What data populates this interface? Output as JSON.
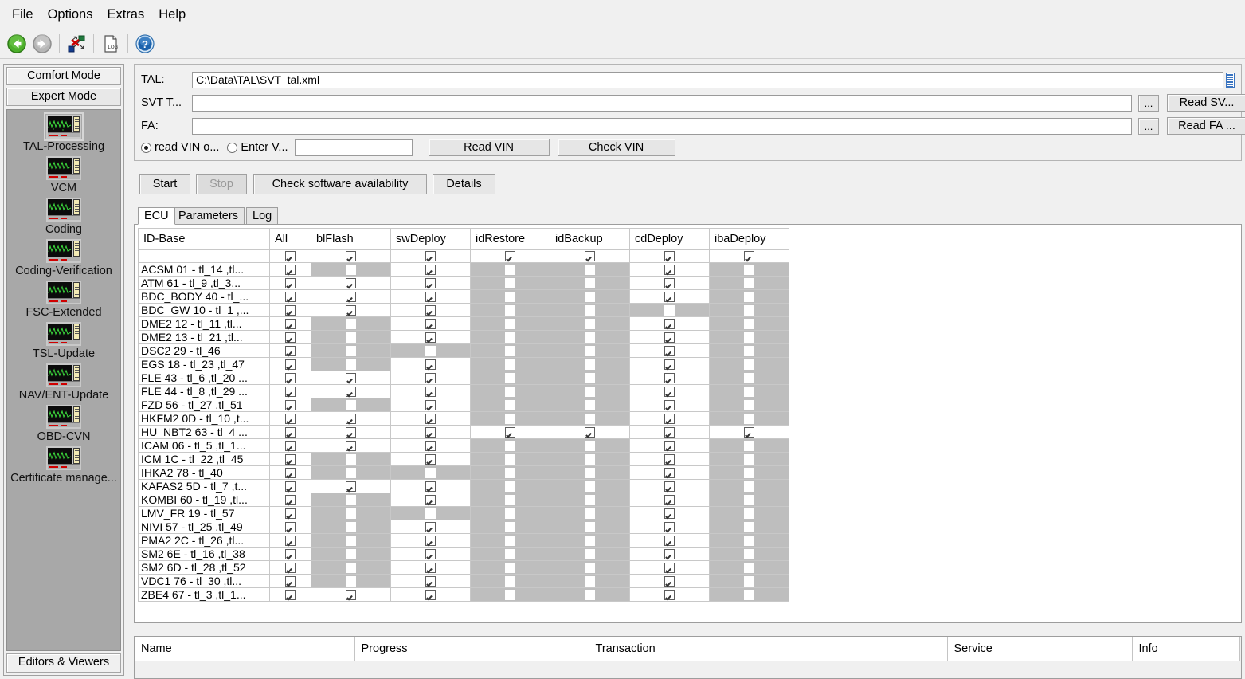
{
  "menubar": {
    "items": [
      "File",
      "Options",
      "Extras",
      "Help"
    ]
  },
  "toolbar": {
    "buttons": [
      {
        "name": "back-button",
        "icon": "back-arrow-icon",
        "enabled": true
      },
      {
        "name": "forward-button",
        "icon": "forward-arrow-icon",
        "enabled": false
      },
      {
        "name": "abort-connection-button",
        "icon": "abort-network-icon",
        "enabled": true
      },
      {
        "name": "log-file-button",
        "icon": "log-document-icon",
        "enabled": true
      },
      {
        "name": "help-button",
        "icon": "help-question-icon",
        "enabled": true
      }
    ]
  },
  "sidebar": {
    "modes": [
      {
        "label": "Comfort Mode",
        "selected": false
      },
      {
        "label": "Expert Mode",
        "selected": true
      }
    ],
    "items": [
      {
        "label": "TAL-Processing",
        "icon": "oscilloscope-icon",
        "active": true
      },
      {
        "label": "VCM",
        "icon": "oscilloscope-icon",
        "active": false
      },
      {
        "label": "Coding",
        "icon": "oscilloscope-icon",
        "active": false
      },
      {
        "label": "Coding-Verification",
        "icon": "oscilloscope-icon",
        "active": false
      },
      {
        "label": "FSC-Extended",
        "icon": "oscilloscope-icon",
        "active": false
      },
      {
        "label": "TSL-Update",
        "icon": "oscilloscope-icon",
        "active": false
      },
      {
        "label": "NAV/ENT-Update",
        "icon": "oscilloscope-icon",
        "active": false
      },
      {
        "label": "OBD-CVN",
        "icon": "oscilloscope-icon",
        "active": false
      },
      {
        "label": "Certificate manage...",
        "icon": "oscilloscope-icon",
        "active": false
      }
    ],
    "footer_button": "Editors & Viewers"
  },
  "form": {
    "tal_label": "TAL:",
    "tal_value": "C:\\Data\\TAL\\SVT  tal.xml",
    "svt_label": "SVT T...",
    "svt_value": "",
    "svt_browse": "...",
    "svt_read_button": "Read SV...",
    "fa_label": "FA:",
    "fa_value": "",
    "fa_browse": "...",
    "fa_read_button": "Read FA ...",
    "radio_read_vin": "read VIN o...",
    "radio_enter_vin": "Enter V...",
    "vin_value": "",
    "read_vin_button": "Read VIN",
    "check_vin_button": "Check VIN",
    "selected_radio": "read_vin"
  },
  "actions": {
    "start": "Start",
    "stop": "Stop",
    "stop_enabled": false,
    "check_availability": "Check software availability",
    "details": "Details"
  },
  "tabs": [
    {
      "label": "ECU",
      "active": true
    },
    {
      "label": "Parameters",
      "active": false
    },
    {
      "label": "Log",
      "active": false
    }
  ],
  "ecu_table": {
    "columns": [
      "ID-Base",
      "All",
      "blFlash",
      "swDeploy",
      "idRestore",
      "idBackup",
      "cdDeploy",
      "ibaDeploy"
    ],
    "header_row_checks": [
      true,
      true,
      true,
      true,
      true,
      true,
      true
    ],
    "rows": [
      {
        "id": "ACSM 01 - tl_14 ,tl...",
        "cells": [
          "c",
          "d",
          "c",
          "d",
          "d",
          "c",
          "d"
        ]
      },
      {
        "id": "ATM 61 - tl_9 ,tl_3...",
        "cells": [
          "c",
          "c",
          "c",
          "d",
          "d",
          "c",
          "d"
        ]
      },
      {
        "id": "BDC_BODY 40 - tl_...",
        "cells": [
          "c",
          "c",
          "c",
          "d",
          "d",
          "c",
          "d"
        ]
      },
      {
        "id": "BDC_GW 10 - tl_1 ,...",
        "cells": [
          "c",
          "c",
          "c",
          "d",
          "d",
          "d",
          "d"
        ]
      },
      {
        "id": "DME2 12 - tl_11 ,tl...",
        "cells": [
          "c",
          "d",
          "c",
          "d",
          "d",
          "c",
          "d"
        ]
      },
      {
        "id": "DME2 13 - tl_21 ,tl...",
        "cells": [
          "c",
          "d",
          "c",
          "d",
          "d",
          "c",
          "d"
        ]
      },
      {
        "id": "DSC2 29 - tl_46",
        "cells": [
          "c",
          "d",
          "d",
          "d",
          "d",
          "c",
          "d"
        ]
      },
      {
        "id": "EGS 18 - tl_23 ,tl_47",
        "cells": [
          "c",
          "d",
          "c",
          "d",
          "d",
          "c",
          "d"
        ]
      },
      {
        "id": "FLE 43 - tl_6 ,tl_20 ...",
        "cells": [
          "c",
          "c",
          "c",
          "d",
          "d",
          "c",
          "d"
        ]
      },
      {
        "id": "FLE 44 - tl_8 ,tl_29 ...",
        "cells": [
          "c",
          "c",
          "c",
          "d",
          "d",
          "c",
          "d"
        ]
      },
      {
        "id": "FZD 56 - tl_27 ,tl_51",
        "cells": [
          "c",
          "d",
          "c",
          "d",
          "d",
          "c",
          "d"
        ]
      },
      {
        "id": "HKFM2 0D - tl_10 ,t...",
        "cells": [
          "c",
          "c",
          "c",
          "d",
          "d",
          "c",
          "d"
        ]
      },
      {
        "id": "HU_NBT2 63 - tl_4 ...",
        "cells": [
          "c",
          "c",
          "c",
          "c",
          "c",
          "c",
          "c"
        ]
      },
      {
        "id": "ICAM 06 - tl_5 ,tl_1...",
        "cells": [
          "c",
          "c",
          "c",
          "d",
          "d",
          "c",
          "d"
        ]
      },
      {
        "id": "ICM 1C - tl_22 ,tl_45",
        "cells": [
          "c",
          "d",
          "c",
          "d",
          "d",
          "c",
          "d"
        ]
      },
      {
        "id": "IHKA2 78 - tl_40",
        "cells": [
          "c",
          "d",
          "d",
          "d",
          "d",
          "c",
          "d"
        ]
      },
      {
        "id": "KAFAS2 5D - tl_7 ,t...",
        "cells": [
          "c",
          "c",
          "c",
          "d",
          "d",
          "c",
          "d"
        ]
      },
      {
        "id": "KOMBI 60 - tl_19 ,tl...",
        "cells": [
          "c",
          "d",
          "c",
          "d",
          "d",
          "c",
          "d"
        ]
      },
      {
        "id": "LMV_FR 19 - tl_57",
        "cells": [
          "c",
          "d",
          "d",
          "d",
          "d",
          "c",
          "d"
        ]
      },
      {
        "id": "NIVI 57 - tl_25 ,tl_49",
        "cells": [
          "c",
          "d",
          "c",
          "d",
          "d",
          "c",
          "d"
        ]
      },
      {
        "id": "PMA2 2C - tl_26 ,tl...",
        "cells": [
          "c",
          "d",
          "c",
          "d",
          "d",
          "c",
          "d"
        ]
      },
      {
        "id": "SM2 6E - tl_16 ,tl_38",
        "cells": [
          "c",
          "d",
          "c",
          "d",
          "d",
          "c",
          "d"
        ]
      },
      {
        "id": "SM2 6D - tl_28 ,tl_52",
        "cells": [
          "c",
          "d",
          "c",
          "d",
          "d",
          "c",
          "d"
        ]
      },
      {
        "id": "VDC1 76 - tl_30 ,tl...",
        "cells": [
          "c",
          "d",
          "c",
          "d",
          "d",
          "c",
          "d"
        ]
      },
      {
        "id": "ZBE4 67 - tl_3 ,tl_1...",
        "cells": [
          "c",
          "c",
          "c",
          "d",
          "d",
          "c",
          "d"
        ]
      }
    ]
  },
  "status_table": {
    "columns": [
      "Name",
      "Progress",
      "Transaction",
      "Service",
      "Info"
    ],
    "rows": []
  },
  "colors": {
    "window_bg": "#f0f0f0",
    "nav_bg": "#a8a8a8",
    "disabled_cell": "#bebebe",
    "table_border": "#c8c8c8",
    "accent_blue": "#3a74c0",
    "green": "#35a02c",
    "red": "#d00000"
  }
}
